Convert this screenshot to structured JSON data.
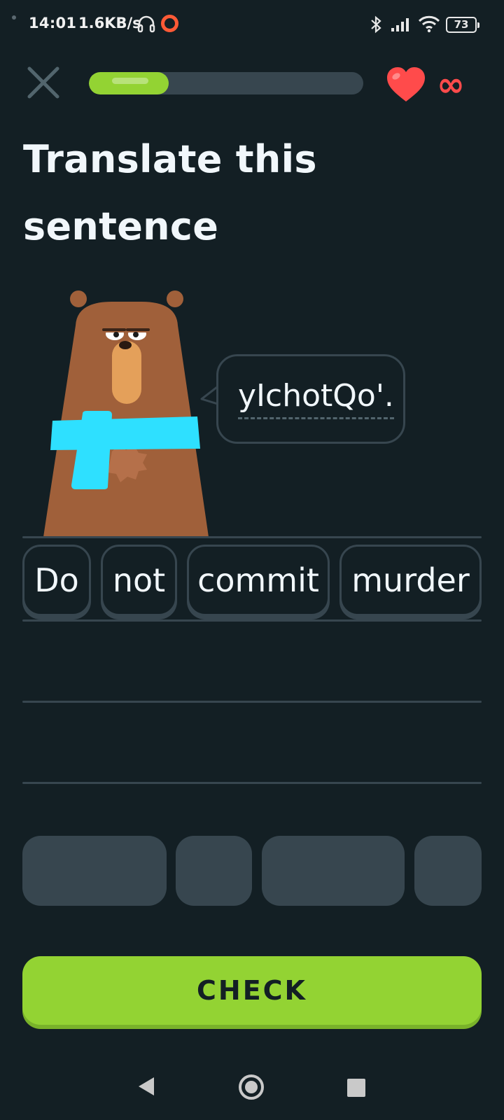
{
  "status_bar": {
    "time": "14:01",
    "network_speed": "1.6KB/s",
    "battery": "73",
    "icons": [
      "headset-icon",
      "ring-icon",
      "bluetooth-icon",
      "signal-icon",
      "wifi-icon",
      "battery-icon"
    ]
  },
  "lesson": {
    "progress_fraction": 0.29,
    "progress_color": "#93d333",
    "hearts_icon": "heart-icon",
    "hearts_value": "∞",
    "hearts_color": "#ff4b4b"
  },
  "title": "Translate this sentence",
  "prompt": {
    "sentence": "yIchotQo'."
  },
  "word_bank": [
    {
      "label": "Do"
    },
    {
      "label": "not"
    },
    {
      "label": "commit"
    },
    {
      "label": "murder"
    }
  ],
  "check_button": {
    "label": "CHECK",
    "color": "#93d333"
  },
  "nav": {
    "icons": [
      "back-icon",
      "home-icon",
      "recents-icon"
    ]
  }
}
